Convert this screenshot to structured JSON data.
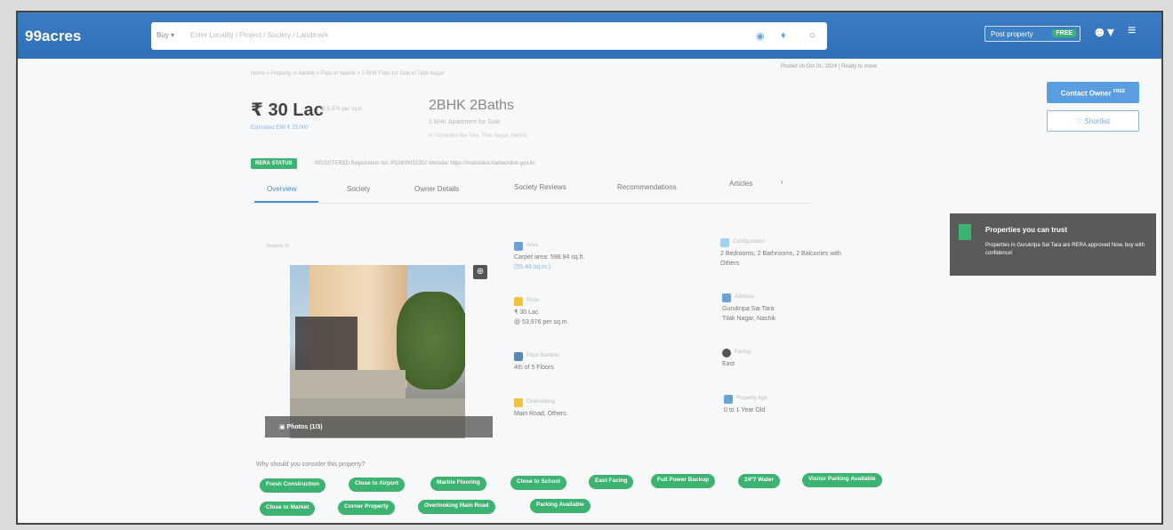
{
  "header": {
    "logo": "99acres",
    "search_mode": "Buy ▾",
    "search_placeholder": "Enter Locality / Project / Society / Landmark",
    "post_property": "Post property",
    "free_badge": "FREE",
    "user_icon": "user-icon",
    "menu_icon": "hamburger-icon"
  },
  "listing": {
    "breadcrumb": "Home > Property in Nashik > Flats in Nashik > 2 BHK Flats for Sale in Tilak Nagar",
    "posted": "Posted on Oct 01, 2024 | Ready to move",
    "price": "₹ 30 Lac",
    "price_sub": "@ 5,376 per sq.ft.",
    "estimate": "Estimated EMI ₹ 25,000",
    "bhk": "2BHK 2Baths",
    "bhk_sub": "2 BHK Apartment for Sale",
    "bhk_sub2": "in Gurukripa Sai Tara, Tilak Nagar, Nashik",
    "contact_label": "Contact Owner",
    "contact_badge": "FREE",
    "shortlist_label": "♡ Shortlist",
    "rera_badge": "RERA STATUS",
    "rera_info": "REGISTERED    Registration No: P51600031352    Website: https://maharera.mahaonline.gov.in/"
  },
  "tabs": [
    {
      "label": "Overview",
      "active": true
    },
    {
      "label": "Society",
      "active": false
    },
    {
      "label": "Owner Details",
      "active": false
    },
    {
      "label": "Society Reviews",
      "active": false
    },
    {
      "label": "Recommendations",
      "active": false
    },
    {
      "label": "Articles",
      "active": false
    },
    {
      "label": "›",
      "active": false
    }
  ],
  "trust": {
    "title": "Properties you can trust",
    "text": "Properties in Gurukripa Sai Tara are RERA approved Now, buy with confidence!"
  },
  "photo": {
    "property_id": "Property ID",
    "photos_label": "▣ Photos (1/3)",
    "zoom_icon": "zoom-icon"
  },
  "details": [
    {
      "label": "Area",
      "value": "Carpet area: 596.94 sq.ft.",
      "value2": "(55.46 sq.m.)",
      "color": "#6aa2d8"
    },
    {
      "label": "Configuration",
      "value": "2 Bedrooms, 2 Bathrooms, 2 Balconies with",
      "value2": "Others",
      "color": "#9fd0f0"
    },
    {
      "label": "Price",
      "value": "₹ 30 Lac",
      "value2": "@ 53,976 per sq.m.",
      "color": "#f0c040"
    },
    {
      "label": "Address",
      "value": "Gurukripa Sai Tara",
      "value2": "Tilak Nagar, Nashik",
      "color": "#6aa2d8"
    },
    {
      "label": "Floor Number",
      "value": "4th of 5 Floors",
      "value2": "",
      "color": "#5b87b8"
    },
    {
      "label": "Facing",
      "value": "East",
      "value2": "",
      "color": "#555555"
    },
    {
      "label": "Overlooking",
      "value": "Main Road, Others",
      "value2": "",
      "color": "#f0c040"
    },
    {
      "label": "Property Age",
      "value": "0 to 1 Year Old",
      "value2": "",
      "color": "#6aa2d8"
    }
  ],
  "consider_title": "Why should you consider this property?",
  "chips": [
    "Fresh Construction",
    "Close to Airport",
    "Marble Flooring",
    "Close to School",
    "East Facing",
    "Full Power Backup",
    "24*7 Water",
    "Visitor Parking Available",
    "Close to Market",
    "Corner Property",
    "Overlooking Main Road",
    "Parking Available"
  ]
}
